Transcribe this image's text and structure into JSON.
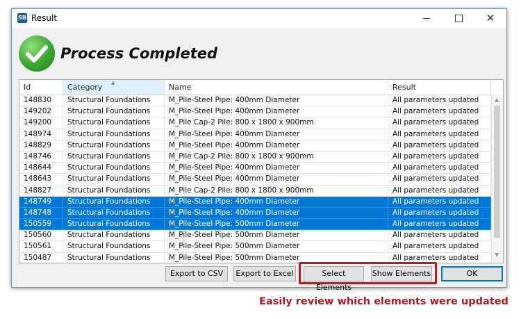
{
  "window": {
    "app_icon_text": "SB",
    "title": "Result",
    "controls": {
      "minimize": "minimize",
      "maximize": "maximize",
      "close": "✕"
    }
  },
  "status": {
    "icon": "check-circle-icon",
    "text": "Process Completed",
    "color": "#3aa630"
  },
  "table": {
    "columns": [
      "Id",
      "Category",
      "Name",
      "Result"
    ],
    "sorted_column": "Category",
    "rows": [
      {
        "id": "148830",
        "category": "Structural Foundations",
        "name": "M_Pile-Steel Pipe: 400mm Diameter",
        "result": "All parameters updated",
        "selected": false
      },
      {
        "id": "149202",
        "category": "Structural Foundations",
        "name": "M_Pile-Steel Pipe: 400mm Diameter",
        "result": "All parameters updated",
        "selected": false
      },
      {
        "id": "149200",
        "category": "Structural Foundations",
        "name": "M_Pile Cap-2 Pile: 800 x 1800 x 900mm",
        "result": "All parameters updated",
        "selected": false
      },
      {
        "id": "148974",
        "category": "Structural Foundations",
        "name": "M_Pile-Steel Pipe: 400mm Diameter",
        "result": "All parameters updated",
        "selected": false
      },
      {
        "id": "148829",
        "category": "Structural Foundations",
        "name": "M_Pile-Steel Pipe: 400mm Diameter",
        "result": "All parameters updated",
        "selected": false
      },
      {
        "id": "148746",
        "category": "Structural Foundations",
        "name": "M_Pile Cap-2 Pile: 800 x 1800 x 900mm",
        "result": "All parameters updated",
        "selected": false
      },
      {
        "id": "148644",
        "category": "Structural Foundations",
        "name": "M_Pile-Steel Pipe: 400mm Diameter",
        "result": "All parameters updated",
        "selected": false
      },
      {
        "id": "148643",
        "category": "Structural Foundations",
        "name": "M_Pile-Steel Pipe: 400mm Diameter",
        "result": "All parameters updated",
        "selected": false
      },
      {
        "id": "148827",
        "category": "Structural Foundations",
        "name": "M_Pile Cap-2 Pile: 800 x 1800 x 900mm",
        "result": "All parameters updated",
        "selected": false
      },
      {
        "id": "148749",
        "category": "Structural Foundations",
        "name": "M_Pile-Steel Pipe: 400mm Diameter",
        "result": "All parameters updated",
        "selected": true
      },
      {
        "id": "148748",
        "category": "Structural Foundations",
        "name": "M_Pile-Steel Pipe: 400mm Diameter",
        "result": "All parameters updated",
        "selected": true
      },
      {
        "id": "150559",
        "category": "Structural Foundations",
        "name": "M_Pile-Steel Pipe: 500mm Diameter",
        "result": "All parameters updated",
        "selected": true
      },
      {
        "id": "150560",
        "category": "Structural Foundations",
        "name": "M_Pile-Steel Pipe: 500mm Diameter",
        "result": "All parameters updated",
        "selected": false
      },
      {
        "id": "150561",
        "category": "Structural Foundations",
        "name": "M_Pile-Steel Pipe: 500mm Diameter",
        "result": "All parameters updated",
        "selected": false
      },
      {
        "id": "150487",
        "category": "Structural Foundations",
        "name": "M_Pile-Steel Pipe: 500mm Diameter",
        "result": "All parameters updated",
        "selected": false
      }
    ],
    "selection_color": "#0078d7"
  },
  "buttons": {
    "export_csv": "Export to CSV",
    "export_excel": "Export to Excel",
    "select_elements": "Select Elements",
    "show_elements": "Show Elements",
    "ok": "OK"
  },
  "annotation": {
    "caption": "Easily review which elements were updated",
    "color": "#b11a22"
  }
}
